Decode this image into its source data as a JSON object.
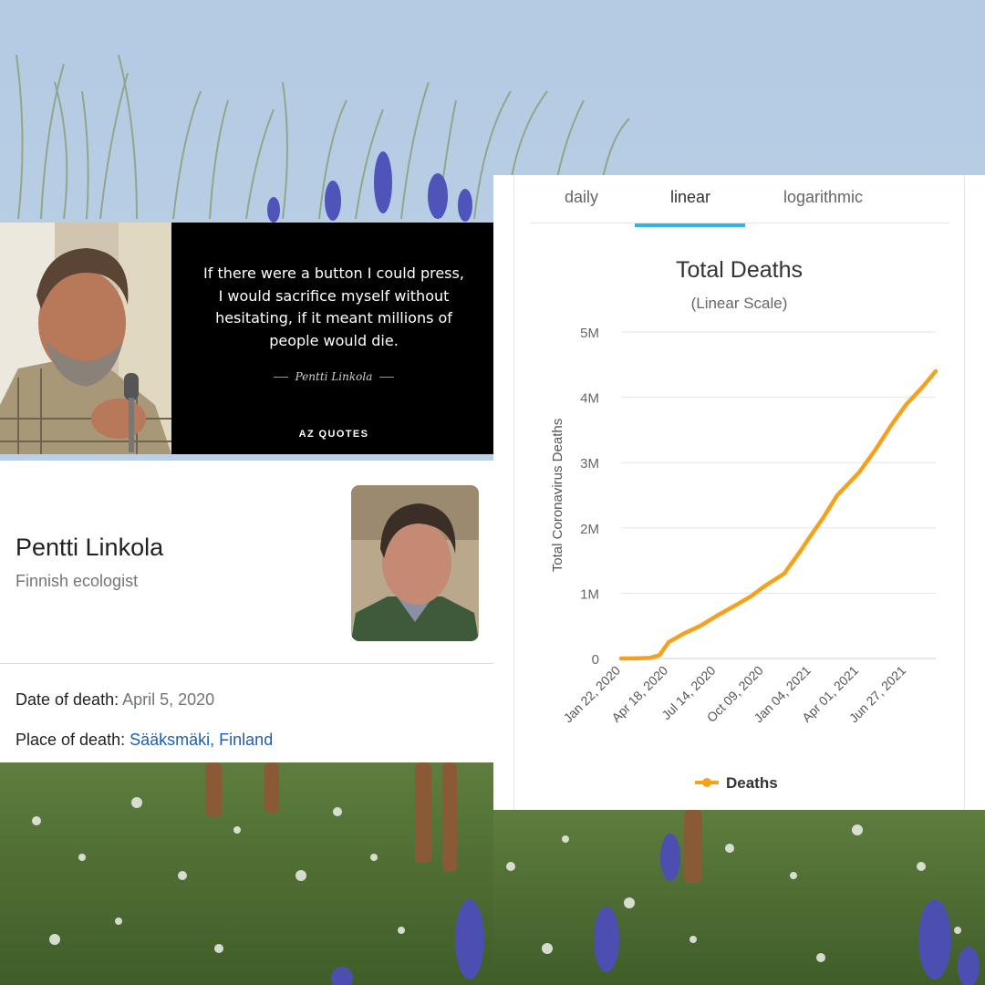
{
  "quote": {
    "lines": [
      "If there were a button I could press,",
      "I would sacrifice myself without",
      "hesitating, if it meant millions of",
      "people would die."
    ],
    "author": "Pentti Linkola",
    "brand": "AZ QUOTES"
  },
  "knowledge_panel": {
    "name": "Pentti Linkola",
    "description": "Finnish ecologist",
    "death_date_label": "Date of death:",
    "death_date_value": "April 5, 2020",
    "death_place_label": "Place of death:",
    "death_place_city": "Sääksmäki",
    "death_place_sep": ",",
    "death_place_country": "Finland"
  },
  "chart_tabs": {
    "daily": "daily",
    "linear": "linear",
    "logarithmic": "logarithmic",
    "active": "linear"
  },
  "colors": {
    "series": "#f5a11b",
    "tab_active": "#33b3e0",
    "link": "#1a5fb4"
  },
  "chart_data": {
    "type": "line",
    "title": "Total Deaths",
    "subtitle": "(Linear Scale)",
    "ylabel": "Total Coronavirus Deaths",
    "ylim": [
      0,
      5000000
    ],
    "y_ticks": [
      {
        "value": 0,
        "label": "0"
      },
      {
        "value": 1000000,
        "label": "1M"
      },
      {
        "value": 2000000,
        "label": "2M"
      },
      {
        "value": 3000000,
        "label": "3M"
      },
      {
        "value": 4000000,
        "label": "4M"
      },
      {
        "value": 5000000,
        "label": "5M"
      }
    ],
    "x_ticks": [
      "Jan 22, 2020",
      "Apr 18, 2020",
      "Jul 14, 2020",
      "Oct 09, 2020",
      "Jan 04, 2021",
      "Apr 01, 2021",
      "Jun 27, 2021"
    ],
    "grid": true,
    "legend_position": "bottom",
    "series": [
      {
        "name": "Deaths",
        "x": [
          "Jan 22, 2020",
          "Feb 15, 2020",
          "Mar 15, 2020",
          "Apr 01, 2020",
          "Apr 18, 2020",
          "May 15, 2020",
          "Jun 15, 2020",
          "Jul 14, 2020",
          "Aug 15, 2020",
          "Sep 15, 2020",
          "Oct 09, 2020",
          "Nov 15, 2020",
          "Dec 15, 2020",
          "Jan 04, 2021",
          "Jan 25, 2021",
          "Feb 20, 2021",
          "Apr 01, 2021",
          "May 01, 2021",
          "Jun 01, 2021",
          "Jun 27, 2021",
          "Jul 25, 2021",
          "Aug 20, 2021"
        ],
        "values": [
          0,
          2000,
          8000,
          50000,
          250000,
          380000,
          500000,
          650000,
          800000,
          950000,
          1100000,
          1300000,
          1650000,
          1900000,
          2150000,
          2500000,
          2850000,
          3200000,
          3600000,
          3900000,
          4150000,
          4400000
        ]
      }
    ]
  }
}
